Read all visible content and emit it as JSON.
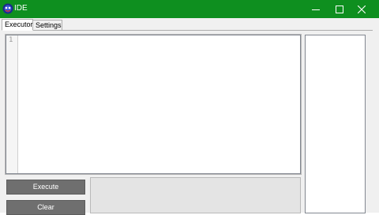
{
  "window": {
    "title": "IDE",
    "accent_color": "#0e8f1f",
    "icon": "app-logo-icon"
  },
  "controls": {
    "minimize_icon": "minimize-icon",
    "maximize_icon": "maximize-icon",
    "close_icon": "close-icon"
  },
  "tabs": [
    {
      "label": "Executor",
      "selected": true
    },
    {
      "label": "Settings",
      "selected": false
    }
  ],
  "editor": {
    "line_numbers": [
      "1"
    ],
    "content": ""
  },
  "buttons": {
    "execute_label": "Execute",
    "clear_label": "Clear"
  }
}
